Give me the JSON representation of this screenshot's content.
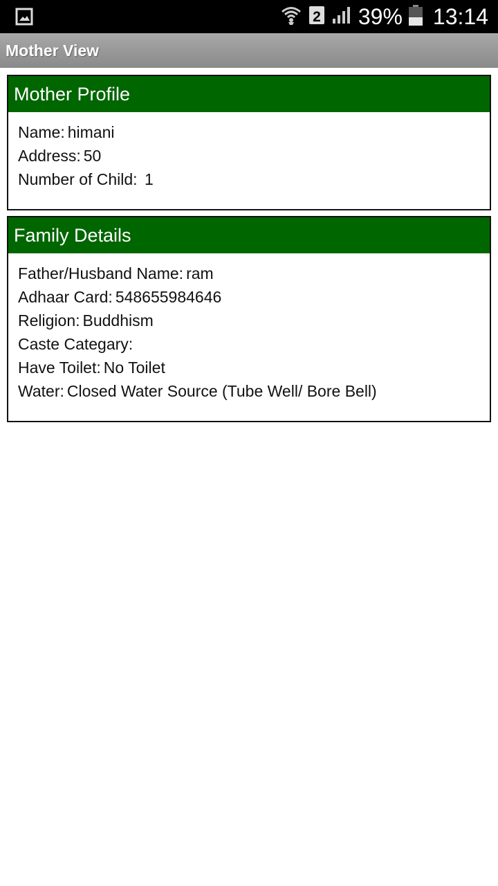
{
  "status_bar": {
    "network_badge": "2",
    "battery": "39%",
    "time": "13:14"
  },
  "app_bar": {
    "title": "Mother View"
  },
  "mother_profile": {
    "header": "Mother Profile",
    "fields": [
      {
        "label": "Name:",
        "value": "himani"
      },
      {
        "label": "Address:",
        "value": "50"
      },
      {
        "label": "Number of Child:",
        "value": " 1"
      }
    ]
  },
  "family_details": {
    "header": "Family Details",
    "fields": [
      {
        "label": "Father/Husband Name:",
        "value": "ram"
      },
      {
        "label": "Adhaar Card:",
        "value": "548655984646"
      },
      {
        "label": "Religion:",
        "value": "Buddhism"
      },
      {
        "label": "Caste Categary:",
        "value": ""
      },
      {
        "label": "Have Toilet:",
        "value": "No Toilet"
      },
      {
        "label": "Water:",
        "value": "Closed Water Source (Tube Well/ Bore Bell)"
      }
    ]
  },
  "colors": {
    "header_green": "#006600",
    "app_bar_gray": "#999999",
    "status_bar": "#000000"
  }
}
